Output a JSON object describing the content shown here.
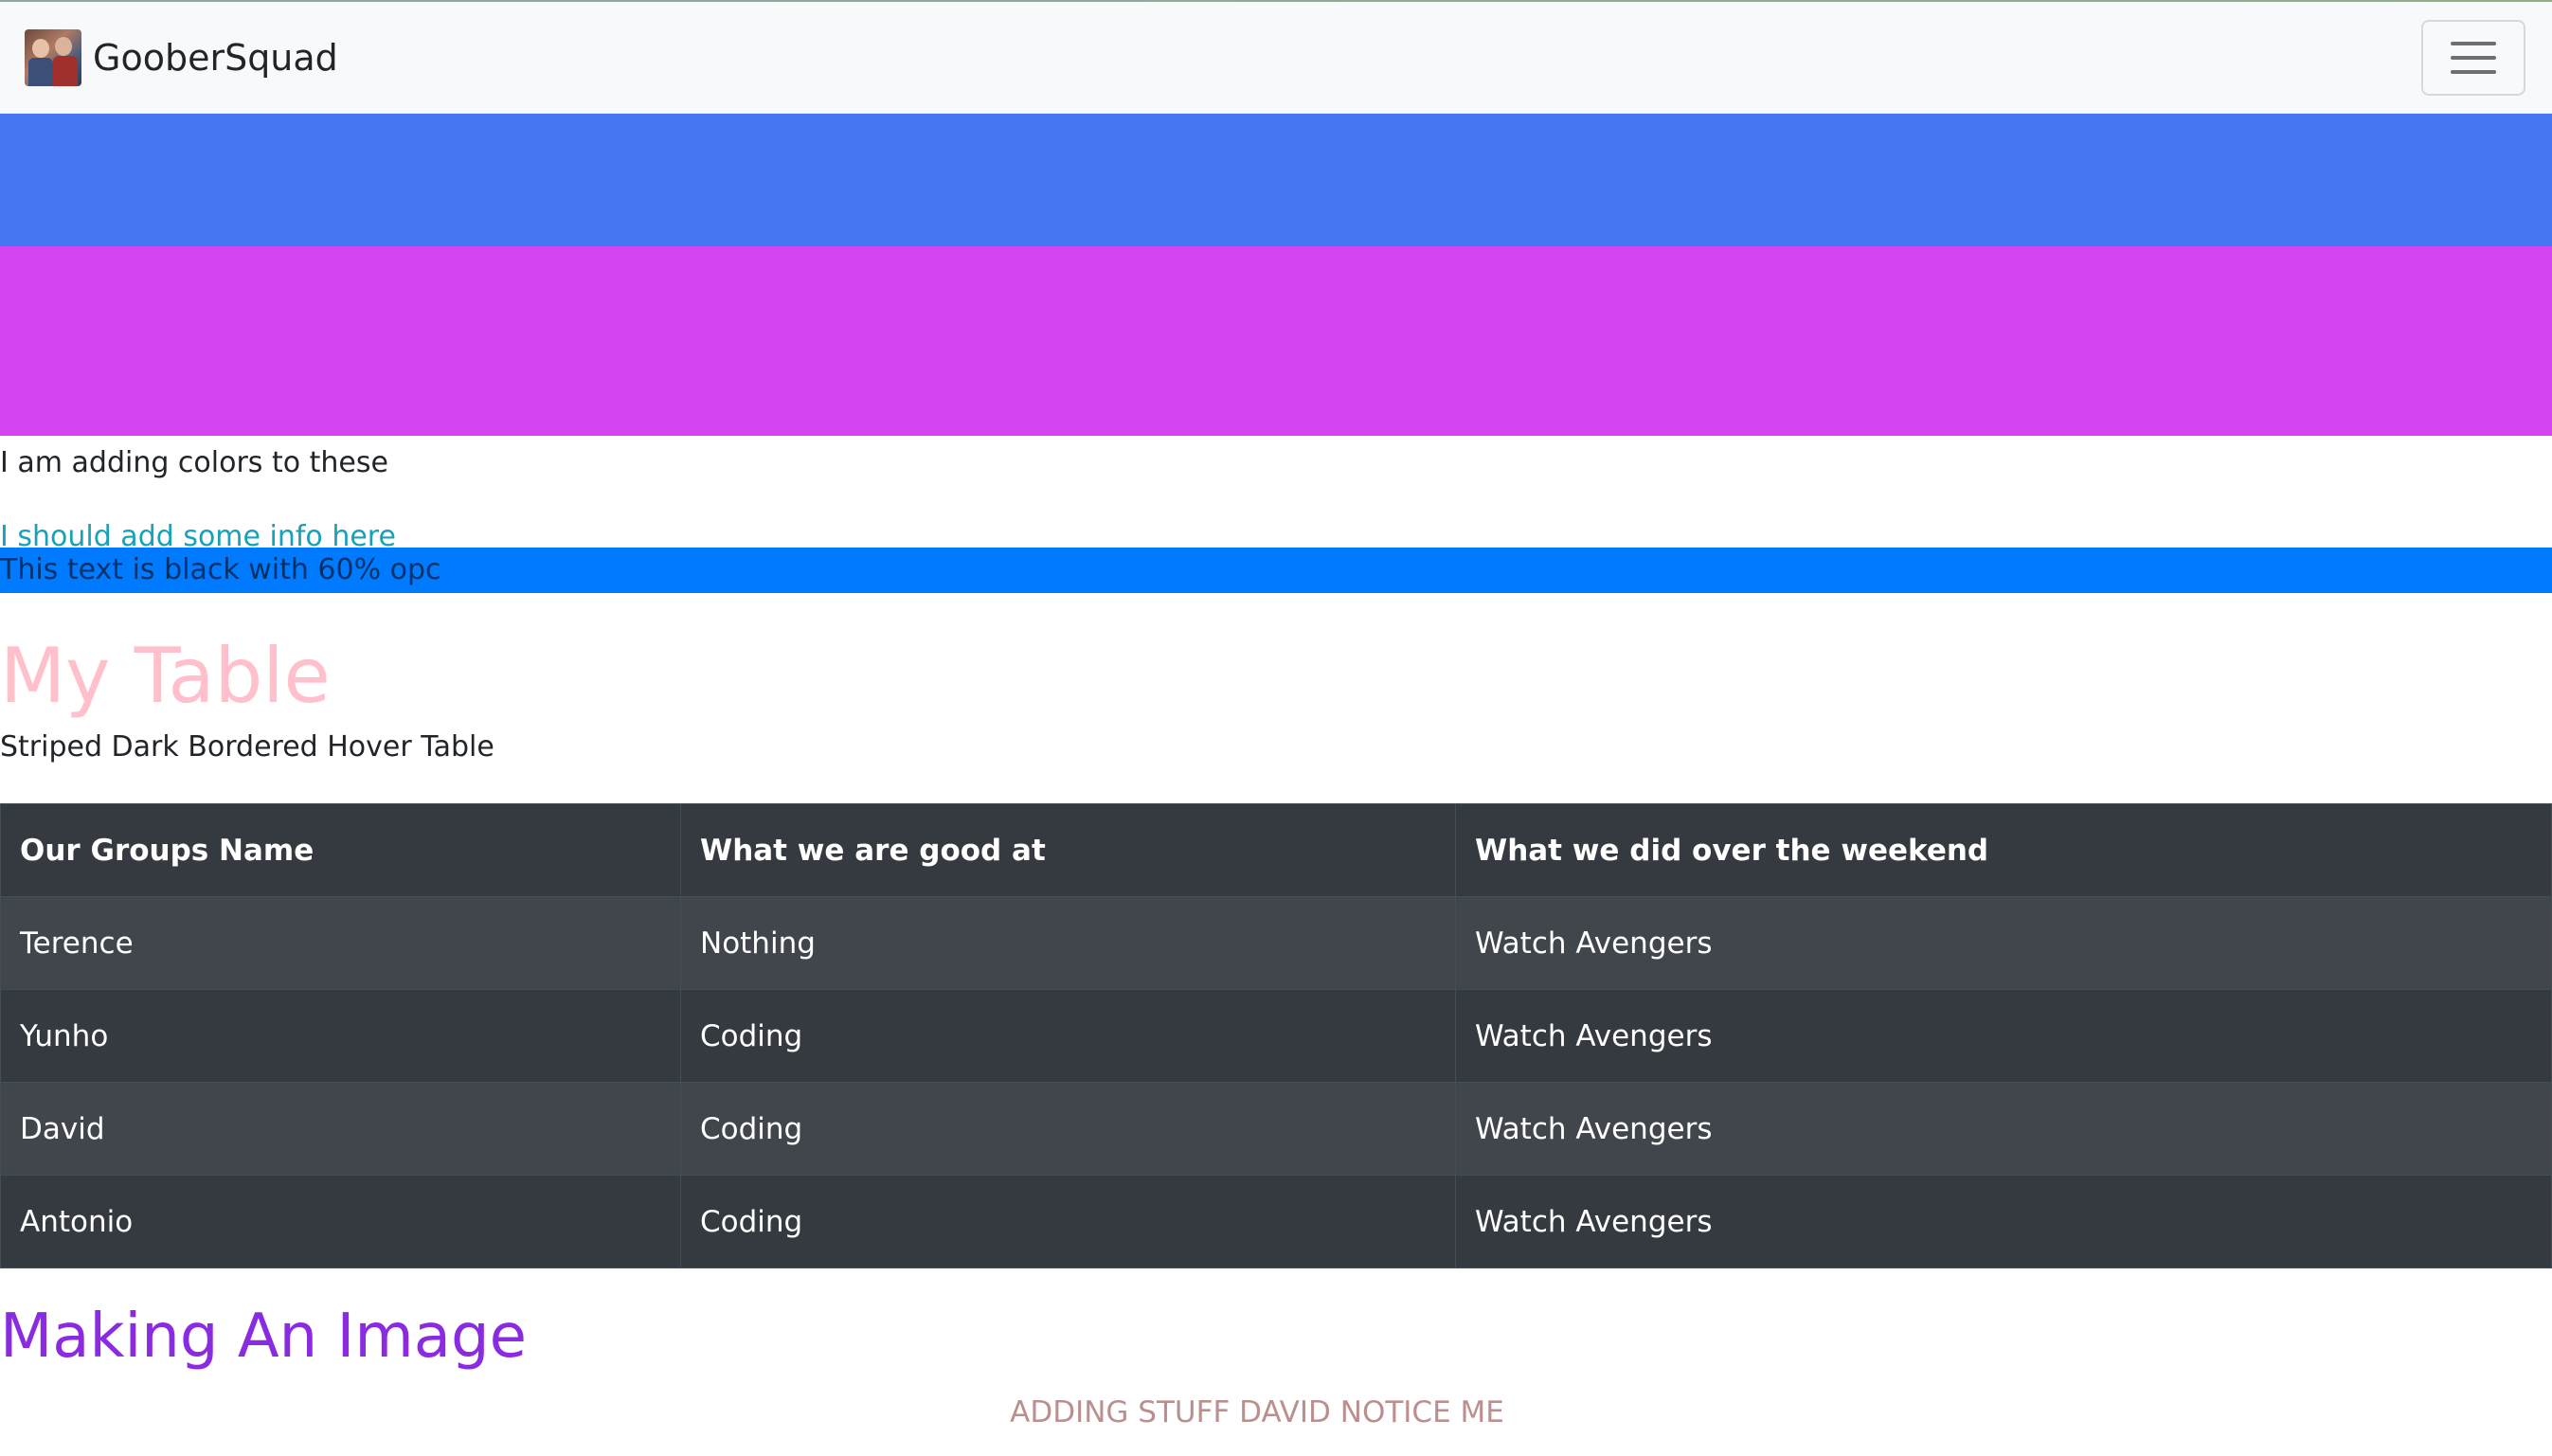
{
  "navbar": {
    "brand_text": "GooberSquad",
    "brand_icon": "group-photo-logo",
    "toggler_icon": "hamburger-menu-icon"
  },
  "content": {
    "line1": "I am adding colors to these",
    "line2": "I should add some info here",
    "line3": "This text is black with 60% opc"
  },
  "table_section": {
    "title": "My Table",
    "subtitle": "Striped Dark Bordered Hover Table",
    "headers": [
      "Our Groups Name",
      "What we are good at",
      "What we did over the weekend"
    ],
    "rows": [
      [
        "Terence",
        "Nothing",
        "Watch Avengers"
      ],
      [
        "Yunho",
        "Coding",
        "Watch Avengers"
      ],
      [
        "David",
        "Coding",
        "Watch Avengers"
      ],
      [
        "Antonio",
        "Coding",
        "Watch Avengers"
      ]
    ]
  },
  "image_section": {
    "title": "Making An Image",
    "notice": "ADDING STUFF DAVID NOTICE ME"
  },
  "colors": {
    "band_blue": "#4676f1",
    "band_purple": "#d444f1",
    "info_text": "#17a2b8",
    "primary_bar": "#007bff",
    "table_title": "#ffc0cb",
    "image_title": "#8a2be2",
    "notice_text": "#bc8f8f"
  }
}
